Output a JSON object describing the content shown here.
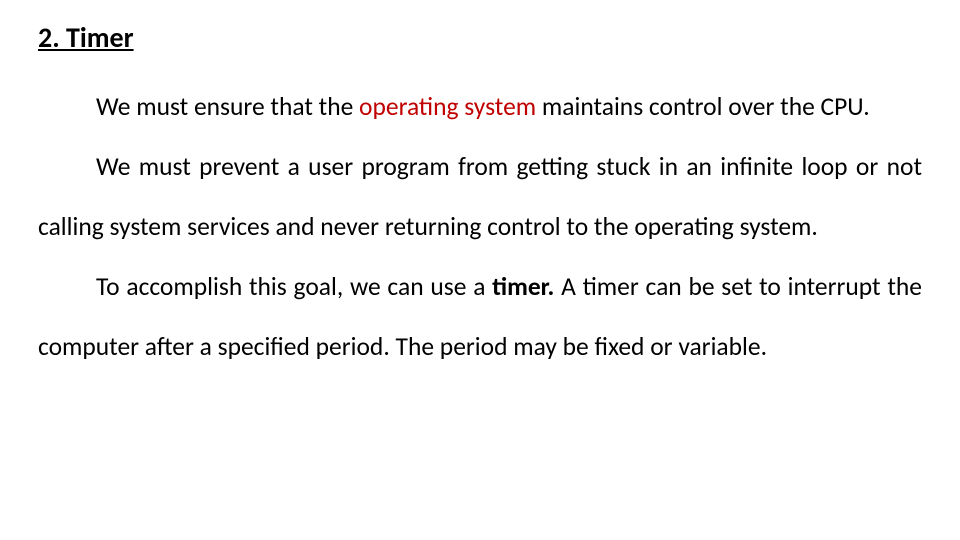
{
  "heading": "2. Timer",
  "p1_lead": "We must ensure that the ",
  "p1_red": "operating system ",
  "p1_tail": "maintains control over the CPU.",
  "p2": "We must prevent a user program from getting stuck in an infinite loop or not calling system services and never returning control to the operating system.",
  "p3_lead": "To accomplish this goal, we can use a ",
  "p3_bold": "timer. ",
  "p3_tail": "A timer can be set to interrupt the computer after a specified period. The period may be fixed or variable."
}
